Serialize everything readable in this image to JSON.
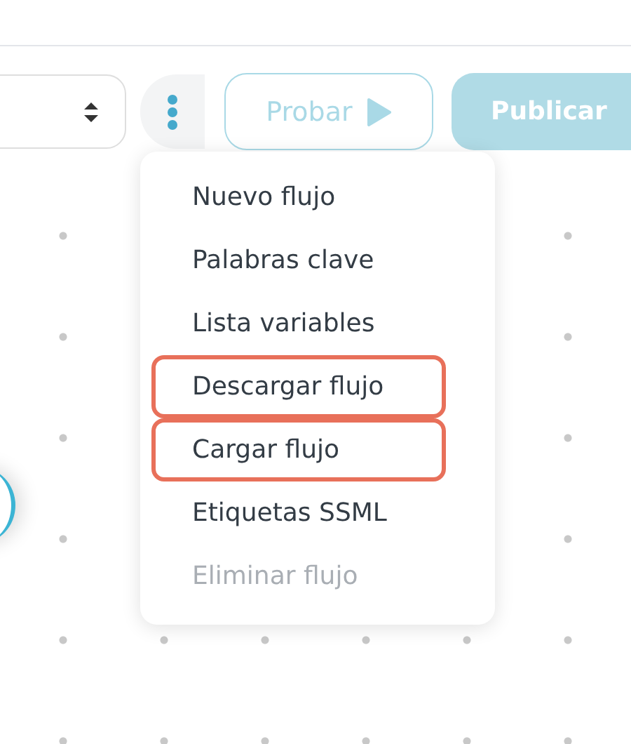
{
  "toolbar": {
    "more_button": {
      "expanded": true
    },
    "test_button": {
      "label": "Probar",
      "disabled": true
    },
    "publish_button": {
      "label": "Publicar",
      "disabled": true
    }
  },
  "menu": {
    "items": [
      {
        "label": "Nuevo flujo",
        "disabled": false,
        "highlighted": false
      },
      {
        "label": "Palabras clave",
        "disabled": false,
        "highlighted": false
      },
      {
        "label": "Lista variables",
        "disabled": false,
        "highlighted": false
      },
      {
        "label": "Descargar flujo",
        "disabled": false,
        "highlighted": true
      },
      {
        "label": "Cargar flujo",
        "disabled": false,
        "highlighted": true
      },
      {
        "label": "Etiquetas SSML",
        "disabled": false,
        "highlighted": false
      },
      {
        "label": "Eliminar flujo",
        "disabled": true,
        "highlighted": false
      }
    ]
  }
}
